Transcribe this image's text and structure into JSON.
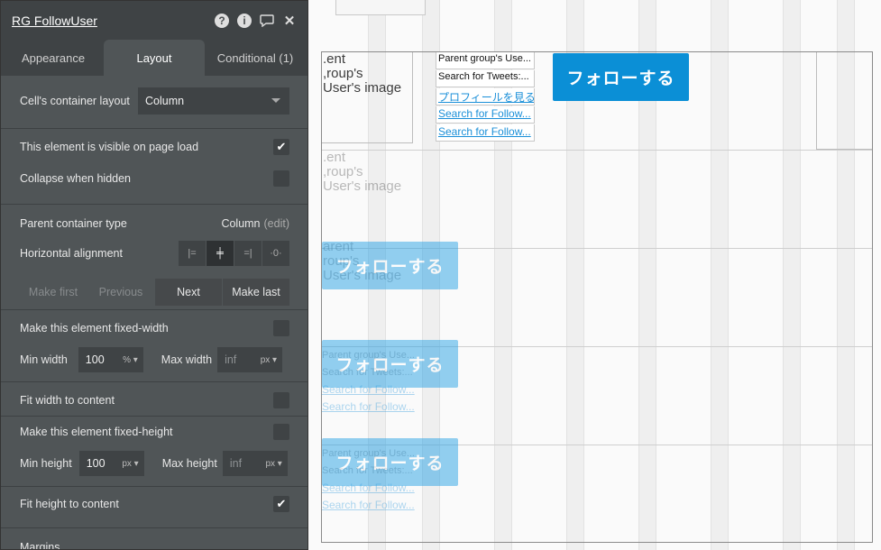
{
  "panel": {
    "title": "RG FollowUser",
    "icons": [
      "help-icon",
      "info-icon",
      "comment-icon",
      "close-icon"
    ],
    "tabs": [
      {
        "label": "Appearance",
        "active": false
      },
      {
        "label": "Layout",
        "active": true
      },
      {
        "label": "Conditional (1)",
        "active": false
      }
    ],
    "cell_layout_label": "Cell's container layout",
    "cell_layout_value": "Column",
    "visible_on_load_label": "This element is visible on page load",
    "visible_on_load_checked": true,
    "collapse_hidden_label": "Collapse when hidden",
    "collapse_hidden_checked": false,
    "parent_type_label": "Parent container type",
    "parent_type_value": "Column",
    "parent_type_edit": "(edit)",
    "h_align_label": "Horizontal alignment",
    "h_align_icons": [
      "align-left-icon",
      "align-center-icon",
      "align-right-icon",
      "align-distribute-icon"
    ],
    "nav_buttons": [
      {
        "label": "Make first",
        "enabled": false
      },
      {
        "label": "Previous",
        "enabled": false
      },
      {
        "label": "Next",
        "enabled": true
      },
      {
        "label": "Make last",
        "enabled": true
      }
    ],
    "fixed_width_label": "Make this element fixed-width",
    "min_width_label": "Min width",
    "min_width_value": "100",
    "min_width_unit": "%",
    "max_width_label": "Max width",
    "max_width_value": "inf",
    "max_width_unit": "px",
    "fit_width_label": "Fit width to content",
    "fixed_height_label": "Make this element fixed-height",
    "min_height_label": "Min height",
    "min_height_value": "100",
    "min_height_unit": "px",
    "max_height_label": "Max height",
    "max_height_value": "inf",
    "max_height_unit": "px",
    "fit_height_label": "Fit height to content",
    "fit_height_checked": true,
    "margins_label": "Margins"
  },
  "canvas": {
    "image_placeholder_lines": [
      "arent",
      "roup's",
      "User's image"
    ],
    "first_image_lines": [
      ".ent",
      ",roup's",
      "User's image"
    ],
    "texts": [
      "Parent group's Use...",
      "Search for Tweets:..."
    ],
    "links": [
      "プロフィールを見る",
      "Search for Follow...",
      "Search for Follow..."
    ],
    "follow_button": "フォローする",
    "ghost_texts": [
      "Parent group's Use...",
      "Search for Tweets:..."
    ],
    "ghost_links": [
      "Search for Follow...",
      "Search for Follow..."
    ]
  }
}
